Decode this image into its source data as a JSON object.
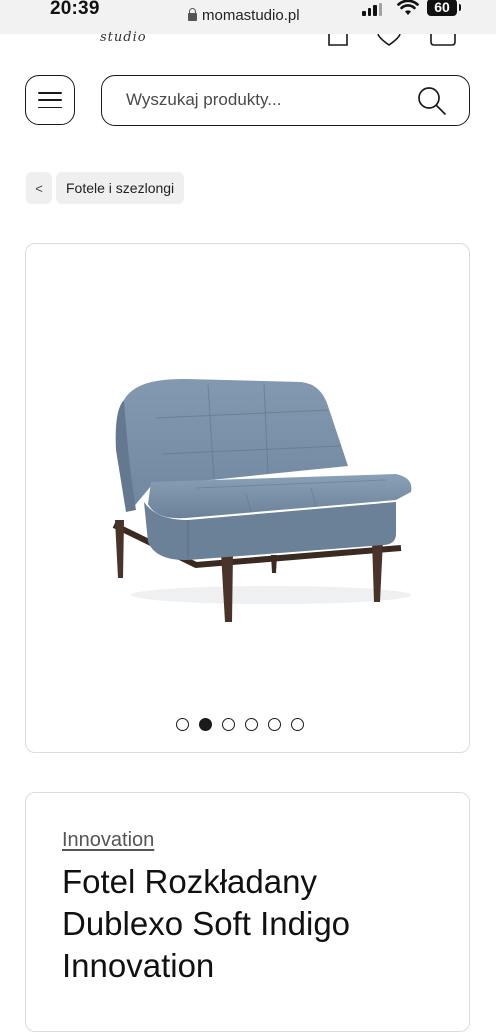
{
  "status_bar": {
    "time": "20:39",
    "url": "momastudio.pl",
    "battery": "60"
  },
  "header": {
    "logo_fragment": "studio",
    "search": {
      "placeholder": "Wyszukaj produkty...",
      "value": ""
    }
  },
  "breadcrumb": {
    "back_symbol": "<",
    "items": [
      {
        "label": "Fotele i szezlongi"
      }
    ]
  },
  "gallery": {
    "image_count": 6,
    "active_index": 1,
    "image_subject": "blue upholstered armchair"
  },
  "product": {
    "brand": "Innovation",
    "title": "Fotel Rozkładany Dublexo Soft Indigo Innovation"
  },
  "colors": {
    "chair_fabric": "#7d95ad",
    "chair_legs": "#4a3328",
    "border": "#dcdcdc",
    "text": "#111111"
  }
}
